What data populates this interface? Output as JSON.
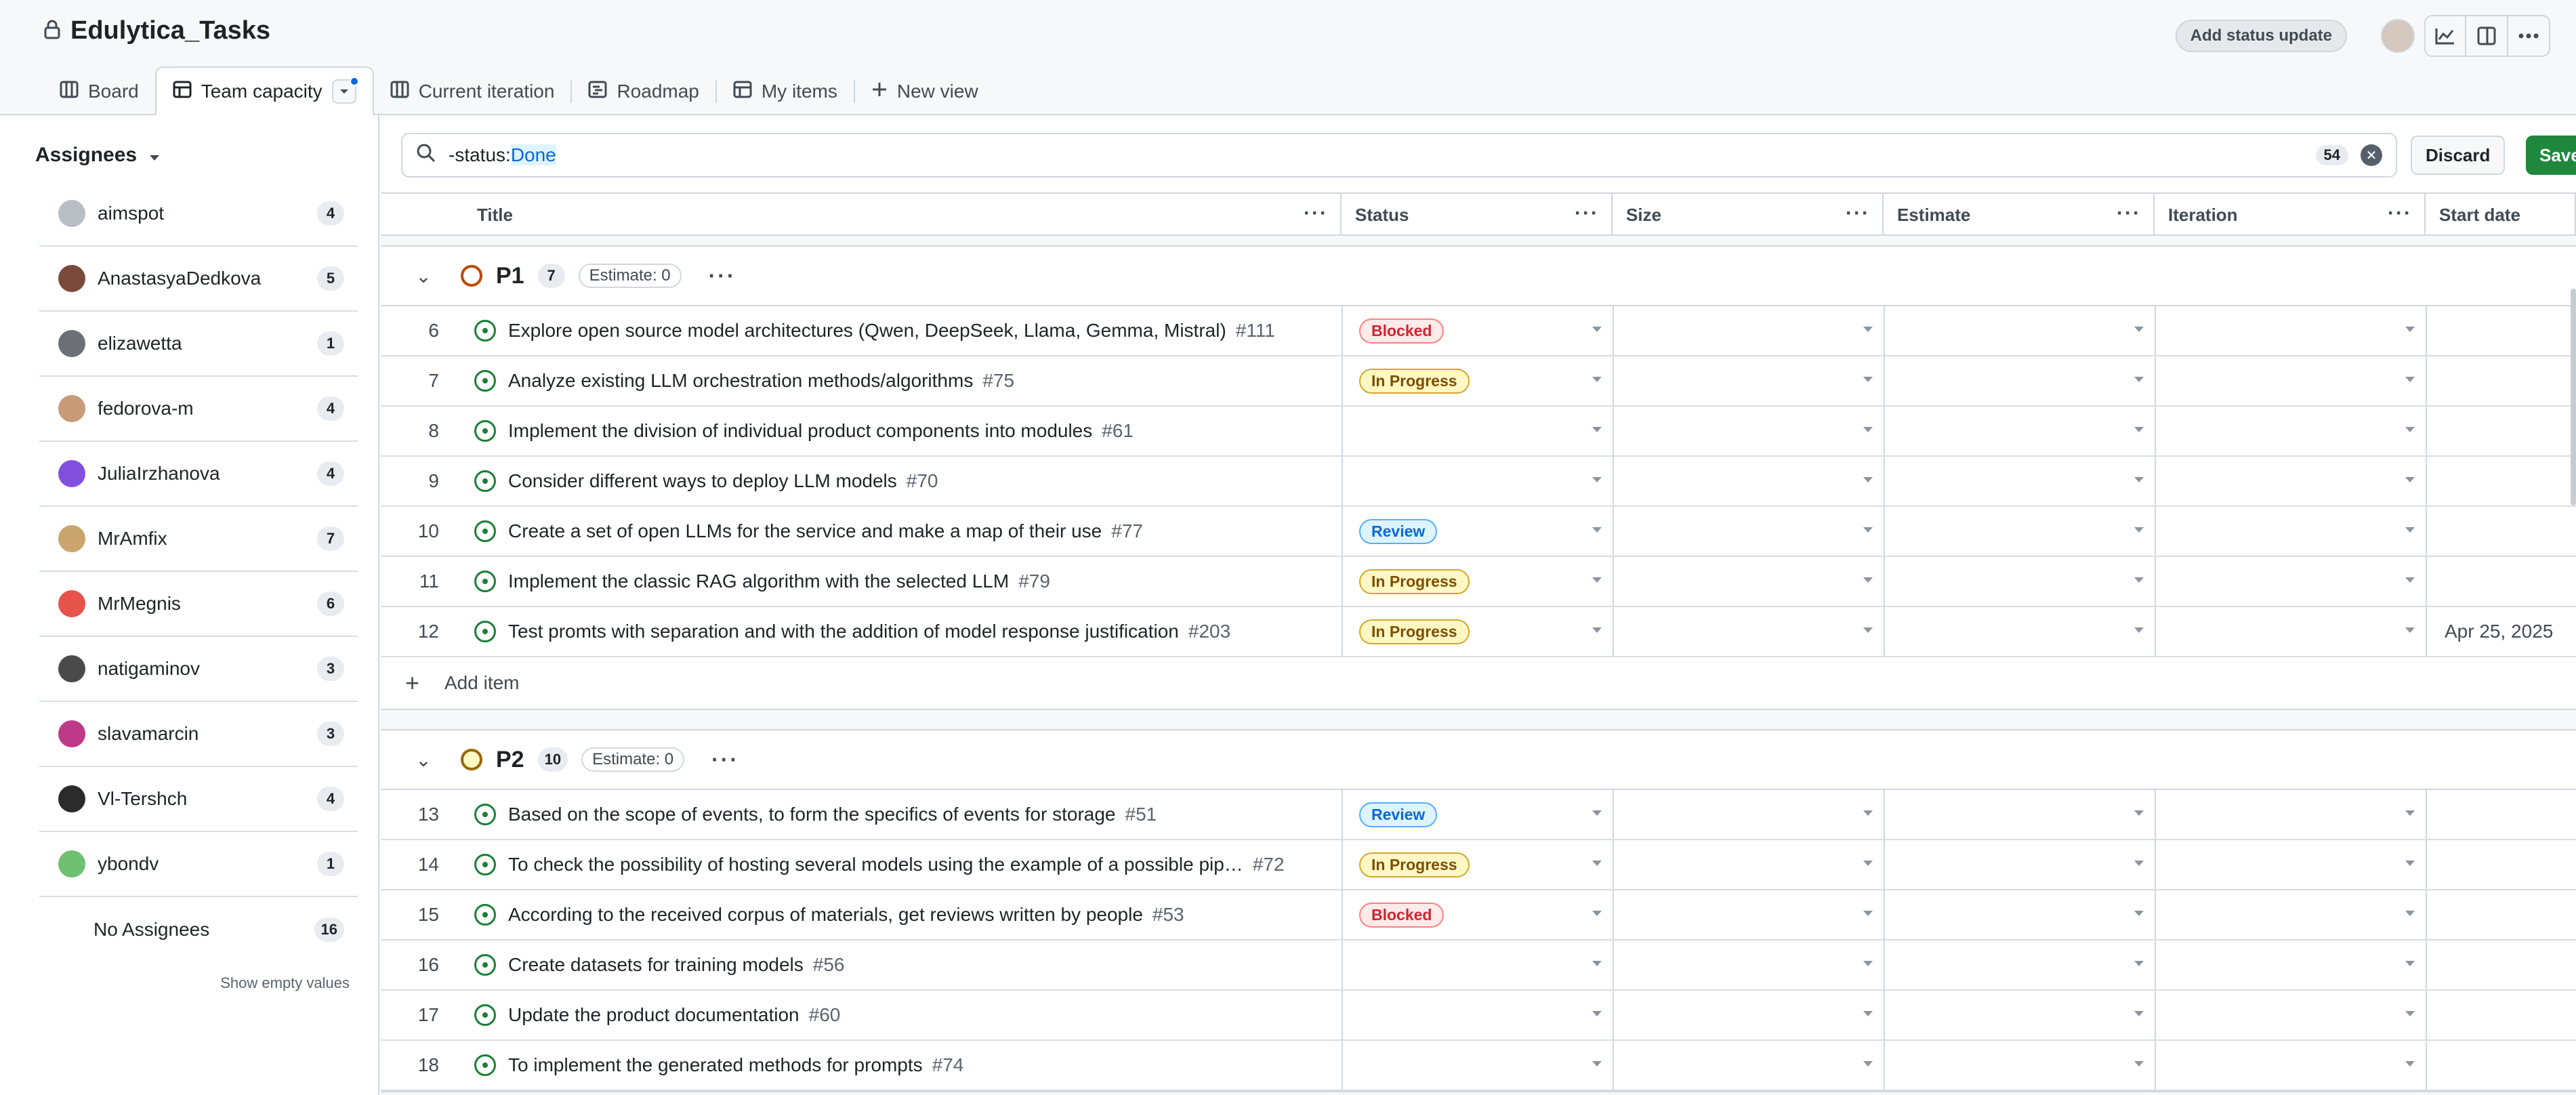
{
  "header": {
    "project_title": "Edulytica_Tasks",
    "status_button": "Add status update"
  },
  "tabs": [
    {
      "label": "Board",
      "icon": "board-icon"
    },
    {
      "label": "Team capacity",
      "icon": "table-icon"
    },
    {
      "label": "Current iteration",
      "icon": "board-icon"
    },
    {
      "label": "Roadmap",
      "icon": "roadmap-icon"
    },
    {
      "label": "My items",
      "icon": "table-icon"
    },
    {
      "label": "New view",
      "icon": "plus-icon"
    }
  ],
  "sidebar": {
    "heading": "Assignees",
    "items": [
      {
        "name": "aimspot",
        "count": "4",
        "color": "#b9bec4"
      },
      {
        "name": "AnastasyaDedkova",
        "count": "5",
        "color": "#7a4b3a"
      },
      {
        "name": "elizawetta",
        "count": "1",
        "color": "#6c6f74"
      },
      {
        "name": "fedorova-m",
        "count": "4",
        "color": "#c89a78"
      },
      {
        "name": "JuliaIrzhanova",
        "count": "4",
        "color": "#8250df"
      },
      {
        "name": "MrAmfix",
        "count": "7",
        "color": "#c9a56b"
      },
      {
        "name": "MrMegnis",
        "count": "6",
        "color": "#e5534b"
      },
      {
        "name": "natigaminov",
        "count": "3",
        "color": "#4a4a4a"
      },
      {
        "name": "slavamarcin",
        "count": "3",
        "color": "#bf3989"
      },
      {
        "name": "Vl-Tershch",
        "count": "4",
        "color": "#2b2b2b"
      },
      {
        "name": "ybondv",
        "count": "1",
        "color": "#6fbf73"
      }
    ],
    "no_assignees": {
      "name": "No Assignees",
      "count": "16"
    },
    "show_empty": "Show empty values"
  },
  "filter": {
    "prefix": "-status:",
    "value": "Done",
    "count": "54",
    "discard": "Discard",
    "save": "Save"
  },
  "columns": [
    "Title",
    "Status",
    "Size",
    "Estimate",
    "Iteration",
    "Start date"
  ],
  "groups": [
    {
      "name": "P1",
      "count": "7",
      "estimate": "Estimate: 0",
      "rows": [
        {
          "num": "6",
          "title": "Explore open source model architectures (Qwen, DeepSeek, Llama, Gemma, Mistral)",
          "ref": "#111",
          "status": "Blocked",
          "start": ""
        },
        {
          "num": "7",
          "title": "Analyze existing LLM orchestration methods/algorithms",
          "ref": "#75",
          "status": "In Progress",
          "start": ""
        },
        {
          "num": "8",
          "title": "Implement the division of individual product components into modules",
          "ref": "#61",
          "status": "",
          "start": ""
        },
        {
          "num": "9",
          "title": "Consider different ways to deploy LLM models",
          "ref": "#70",
          "status": "",
          "start": ""
        },
        {
          "num": "10",
          "title": "Create a set of open LLMs for the service and make a map of their use",
          "ref": "#77",
          "status": "Review",
          "start": ""
        },
        {
          "num": "11",
          "title": "Implement the classic RAG algorithm with the selected LLM",
          "ref": "#79",
          "status": "In Progress",
          "start": ""
        },
        {
          "num": "12",
          "title": "Test promts with separation and with the addition of model response justification",
          "ref": "#203",
          "status": "In Progress",
          "start": "Apr 25, 2025"
        }
      ],
      "add_item": "Add item"
    },
    {
      "name": "P2",
      "count": "10",
      "estimate": "Estimate: 0",
      "rows": [
        {
          "num": "13",
          "title": "Based on the scope of events, to form the specifics of events for storage",
          "ref": "#51",
          "status": "Review",
          "start": ""
        },
        {
          "num": "14",
          "title": "To check the possibility of hosting several models using the example of a possible pip…",
          "ref": "#72",
          "status": "In Progress",
          "start": ""
        },
        {
          "num": "15",
          "title": "According to the received corpus of materials, get reviews written by people",
          "ref": "#53",
          "status": "Blocked",
          "start": ""
        },
        {
          "num": "16",
          "title": "Create datasets for training models",
          "ref": "#56",
          "status": "",
          "start": ""
        },
        {
          "num": "17",
          "title": "Update the product documentation",
          "ref": "#60",
          "status": "",
          "start": ""
        },
        {
          "num": "18",
          "title": "To implement the generated methods for prompts",
          "ref": "#74",
          "status": "",
          "start": ""
        }
      ]
    }
  ]
}
